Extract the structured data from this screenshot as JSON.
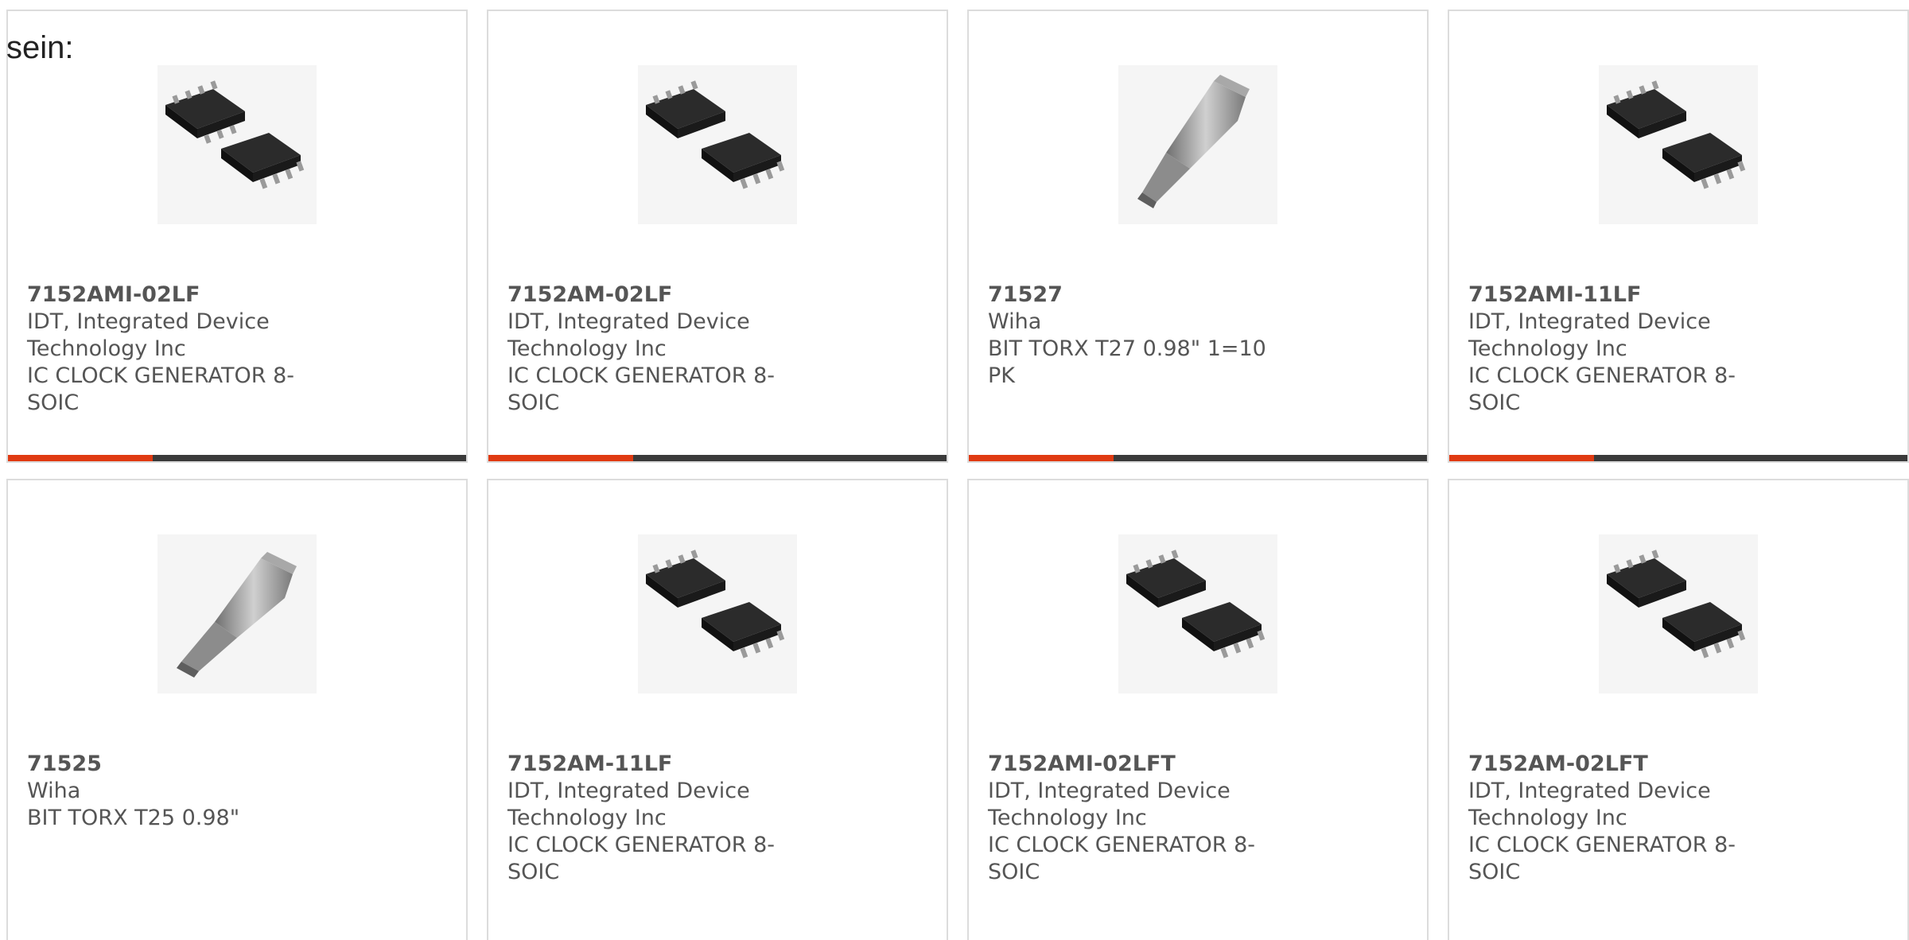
{
  "intro_text": "sein:",
  "colors": {
    "accent": "#e03a12",
    "bar": "#3a3a3a",
    "text": "#555555",
    "border": "#dcdcdc"
  },
  "products": [
    {
      "part_number": "7152AMI-02LF",
      "manufacturer": "IDT, Integrated Device Technology Inc",
      "description": "IC CLOCK GENERATOR 8-SOIC",
      "image_icon": "soic-8-chip-icon"
    },
    {
      "part_number": "7152AM-02LF",
      "manufacturer": "IDT, Integrated Device Technology Inc",
      "description": "IC CLOCK GENERATOR 8-SOIC",
      "image_icon": "soic-8-chip-icon"
    },
    {
      "part_number": "71527",
      "manufacturer": "Wiha",
      "description": "BIT TORX T27 0.98\" 1=10 PK",
      "image_icon": "torx-bit-icon"
    },
    {
      "part_number": "7152AMI-11LF",
      "manufacturer": "IDT, Integrated Device Technology Inc",
      "description": "IC CLOCK GENERATOR 8-SOIC",
      "image_icon": "soic-8-chip-icon"
    },
    {
      "part_number": "71525",
      "manufacturer": "Wiha",
      "description": "BIT TORX T25 0.98\"",
      "image_icon": "torx-bit-icon"
    },
    {
      "part_number": "7152AM-11LF",
      "manufacturer": "IDT, Integrated Device Technology Inc",
      "description": "IC CLOCK GENERATOR 8-SOIC",
      "image_icon": "soic-8-chip-icon"
    },
    {
      "part_number": "7152AMI-02LFT",
      "manufacturer": "IDT, Integrated Device Technology Inc",
      "description": "IC CLOCK GENERATOR 8-SOIC",
      "image_icon": "soic-8-chip-icon"
    },
    {
      "part_number": "7152AM-02LFT",
      "manufacturer": "IDT, Integrated Device Technology Inc",
      "description": "IC CLOCK GENERATOR 8-SOIC",
      "image_icon": "soic-8-chip-icon"
    }
  ]
}
